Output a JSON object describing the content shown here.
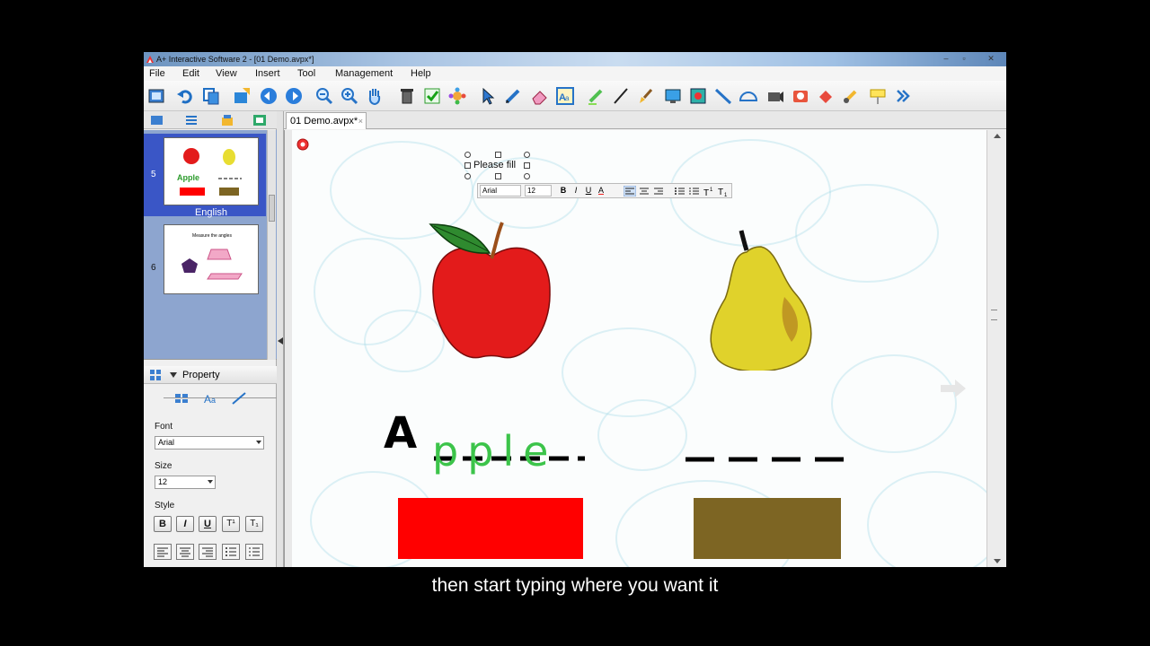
{
  "window": {
    "title": "A+ Interactive Software 2 - [01 Demo.avpx*]",
    "buttons": [
      "–",
      "▫",
      "✕"
    ]
  },
  "menu": [
    "File",
    "Edit",
    "View",
    "Insert",
    "Tool",
    "Management",
    "Help"
  ],
  "toolbar_icons": [
    "open-icon",
    "undo-icon",
    "copy-icon",
    "import-icon",
    "back-icon",
    "forward-icon",
    "zoom-out-icon",
    "zoom-in-icon",
    "hand-icon",
    "trash-icon",
    "check-icon",
    "gear-icon",
    "cursor-icon",
    "pen-icon",
    "eraser-icon",
    "text-icon",
    "highlighter-icon",
    "line-pen-icon",
    "brush-icon",
    "screen-icon",
    "capture-icon",
    "ruler-icon",
    "protractor-icon",
    "camera-icon",
    "photo-icon",
    "fill-icon",
    "pointer-icon",
    "curtain-icon",
    "more-icon"
  ],
  "slides": [
    {
      "number": "5",
      "label": "English",
      "selected": true
    },
    {
      "number": "6",
      "thumb_title": "Measure the angles"
    }
  ],
  "property_panel": {
    "title": "Property",
    "font_label": "Font",
    "font_value": "Arial",
    "size_label": "Size",
    "size_value": "12",
    "style_label": "Style",
    "style_buttons": [
      "B",
      "I",
      "U",
      "T¹",
      "T₁"
    ]
  },
  "doc_tab": {
    "label": "01 Demo.avpx*",
    "close": "×"
  },
  "canvas": {
    "textbox_text": "Please fill",
    "format_bar": {
      "font": "Arial",
      "size": "12",
      "buttons": [
        "B",
        "I",
        "U",
        "A"
      ]
    },
    "letter_a": "A",
    "handwritten_word": "pple",
    "colors": {
      "apple_swatch": "#ff0000",
      "pear_swatch": "#7d6523",
      "handwriting": "#3cc44a"
    }
  },
  "subtitle": "then start typing where you want it"
}
